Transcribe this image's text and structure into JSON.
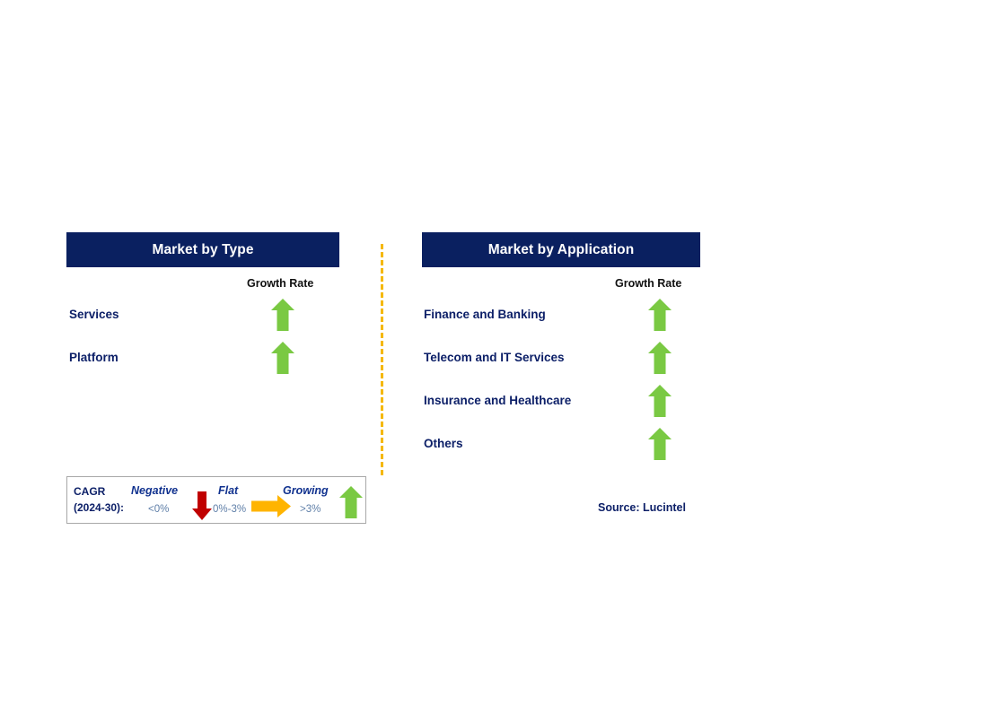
{
  "colors": {
    "header_bg": "#0a2060",
    "header_text": "#ffffff",
    "label_navy": "#0d2068",
    "growth_green": "#7ac943",
    "negative_red": "#c00000",
    "flat_orange": "#ffb400",
    "divider_orange": "#f5b800",
    "legend_value_blue": "#5f7fa8"
  },
  "panels": [
    {
      "title": "Market by Type",
      "growth_rate_header": "Growth Rate",
      "rows": [
        {
          "label": "Services",
          "growth": "growing",
          "icon": "arrow-up-green-icon"
        },
        {
          "label": "Platform",
          "growth": "growing",
          "icon": "arrow-up-green-icon"
        }
      ]
    },
    {
      "title": "Market by Application",
      "growth_rate_header": "Growth Rate",
      "rows": [
        {
          "label": "Finance and Banking",
          "growth": "growing",
          "icon": "arrow-up-green-icon"
        },
        {
          "label": "Telecom and IT Services",
          "growth": "growing",
          "icon": "arrow-up-green-icon"
        },
        {
          "label": "Insurance and Healthcare",
          "growth": "growing",
          "icon": "arrow-up-green-icon"
        },
        {
          "label": "Others",
          "growth": "growing",
          "icon": "arrow-up-green-icon"
        }
      ]
    }
  ],
  "legend": {
    "cagr_line1": "CAGR",
    "cagr_line2": "(2024-30):",
    "items": [
      {
        "term": "Negative",
        "value": "<0%",
        "icon": "arrow-down-red-icon"
      },
      {
        "term": "Flat",
        "value": "0%-3%",
        "icon": "arrow-right-orange-icon"
      },
      {
        "term": "Growing",
        "value": ">3%",
        "icon": "arrow-up-green-icon"
      }
    ]
  },
  "source": "Source: Lucintel"
}
